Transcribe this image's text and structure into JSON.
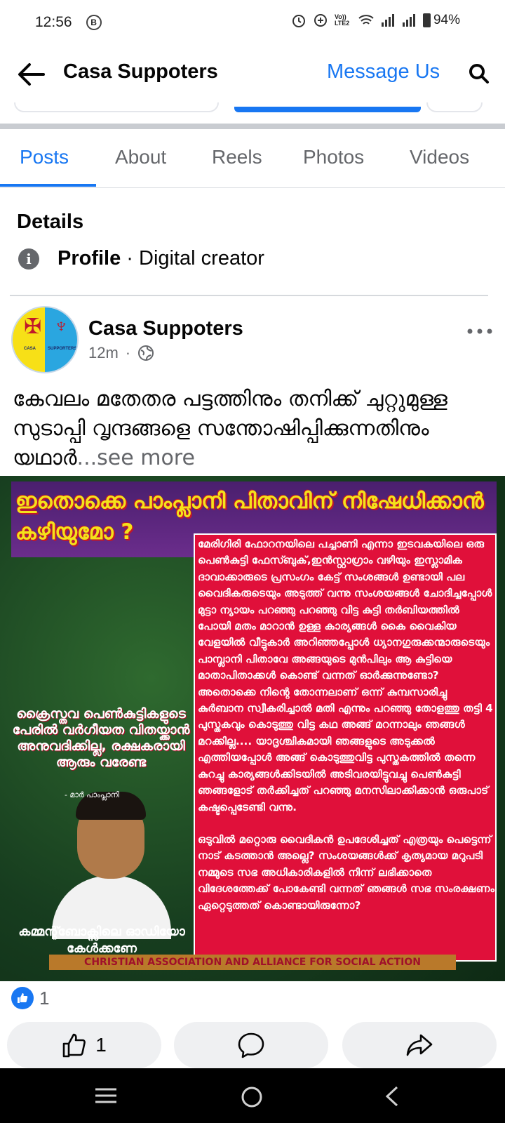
{
  "status_bar": {
    "time": "12:56",
    "b_badge": "B",
    "network": "Vo)) LTE2",
    "battery": "94%"
  },
  "header": {
    "title": "Casa Suppoters",
    "message_button": "Message Us"
  },
  "tabs": [
    {
      "label": "Posts",
      "active": true
    },
    {
      "label": "About",
      "active": false
    },
    {
      "label": "Reels",
      "active": false
    },
    {
      "label": "Photos",
      "active": false
    },
    {
      "label": "Videos",
      "active": false
    }
  ],
  "details": {
    "title": "Details",
    "profile_label": "Profile",
    "profile_value": " · Digital creator"
  },
  "post": {
    "author": "Casa Suppoters",
    "time": "12m",
    "separator": "·",
    "avatar_left_label": "CASA",
    "avatar_right_label": "SUPPORTERS",
    "text": "കേവലം മതേതര പട്ടത്തിനും തനിക്ക് ചുറ്റുമുള്ള സുടാപ്പി വൃന്ദങ്ങളെ സന്തോഷിപ്പിക്കുന്നതിനും യഥാർ",
    "see_more": "...see more",
    "image": {
      "headline": "ഇതൊക്കെ പാംപ്ലാനി പിതാവിന് നിഷേധിക്കാൻ കഴിയുമോ ?",
      "body_1": "മേരിഗിരി ഫോറനയിലെ പച്ചാണി എന്നാ ഇടവകയിലെ ഒരു പെൺകുട്ടി ഫേസ്ബുക്,ഇൻസ്റ്റാഗ്രാം വഴിയും ഇസ്ലാമിക ദാവാക്കാരുടെ പ്രസംഗം കേട്ട് സംശങ്ങൾ ഉണ്ടായി പല വൈദികരുടെയും അടുത്ത് വന്നു സംശയങ്ങൾ ചോദിച്ചപ്പോൾ മുട്ടാ ന്യായം പറഞ്ഞു പറഞ്ഞു വിട്ട കുട്ടി തർബിയത്തിൽ പോയി മതം മാറാൻ ഉള്ള കാര്യങ്ങൾ കൈ വൈകിയ വേളയിൽ വീട്ടുകാർ അറിഞ്ഞപ്പോൾ ധ്യാനഗുരുക്കന്മാരുടെയും പാമ്പ്ലാനി പിതാവേ അങ്ങയുടെ മുൻപിലും ആ കുട്ടിയെ മാതാപിതാക്കൾ കൊണ്ട് വന്നത് ഓർക്കുന്നുണ്ടോ? അതൊക്കെ നിന്റെ തോന്നലാണ് ഒന്ന് കുമ്പസാരിച്ചു കുർബാന സ്വീകരിച്ചാൽ മതി എന്നും പറഞ്ഞു തോളത്തു തട്ടി 4 പുസ്തകവും കൊടുത്തു വിട്ട കഥ അങ്ങ് മറന്നാലും ഞങ്ങൾ മറക്കില്ല.... യാദൃശ്ചികമായി ഞങ്ങളുടെ അടുക്കൽ എത്തിയപ്പോൾ അങ്ങ് കൊടുത്തുവിട്ട പുസ്തകത്തിൽ തന്നെ കുറച്ചു കാര്യങ്ങൾക്കിടയിൽ അടിവരയിട്ടുവച്ചു പെൺകുട്ടി ഞങ്ങളോട് തർക്കിച്ചത് പറഞ്ഞു മനസിലാക്കിക്കാൻ ഒരുപാട് കഷ്ടപ്പെടേണ്ടി വന്നു.",
      "body_2": "ഒടുവിൽ മറ്റൊരു വൈദികൻ ഉപദേശിച്ചത് എത്രയും പെട്ടെന്ന് നാട് കടത്താൻ അല്ലെ? സംശയങ്ങൾക്ക് കൃത്യമായ മറുപടി നമ്മുടെ സഭ അധികാരികളിൽ നിന്ന് ലഭിക്കാതെ വിദേശത്തേക്ക് പോകേണ്ടി വന്നത് ഞങ്ങൾ സഭ സംരക്ഷണം ഏറ്റെടുത്തത് കൊണ്ടായിരുന്നോ?",
      "quote": "ക്രൈസ്തവ പെൺകുട്ടികളുടെ പേരിൽ വർഗീയത വിതയ്ക്കാൻ അനുവദിക്കില്ല, രക്ഷകരായി ആരും വരേണ്ട",
      "quote_by": "- മാർ പാംപ്ലാനി",
      "bottom_left": "കമ്മന്റ്ബോക്സിലെ ഓഡിയോ കേൾക്കണേ",
      "footer": "CHRISTIAN ASSOCIATION AND ALLIANCE FOR SOCIAL ACTION"
    },
    "reaction_count": "1",
    "like_count": "1"
  },
  "colors": {
    "accent": "#1877f2",
    "poster_red": "#e0103a",
    "poster_yellow": "#f4e21b"
  }
}
